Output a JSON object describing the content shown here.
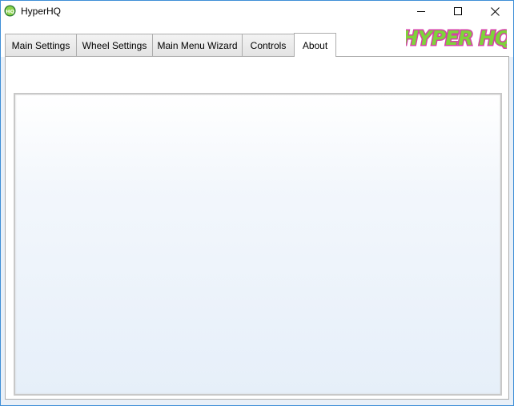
{
  "window": {
    "title": "HyperHQ",
    "app_icon": "hyperhq-app-icon"
  },
  "titlebar_buttons": {
    "minimize_icon": "minimize-icon",
    "maximize_icon": "maximize-icon",
    "close_icon": "close-icon"
  },
  "tabs": [
    {
      "label": "Main Settings",
      "active": false
    },
    {
      "label": "Wheel Settings",
      "active": false
    },
    {
      "label": "Main Menu Wizard",
      "active": false
    },
    {
      "label": "Controls",
      "active": false
    },
    {
      "label": "About",
      "active": true
    }
  ],
  "logo": {
    "text": "HYPER HQ",
    "colors": {
      "fill": "#7ed33a",
      "outline": "#d63fa8"
    }
  },
  "colors": {
    "window_border": "#3f8fd7",
    "panel_border": "#adadad",
    "content_gradient_bottom": "#e6eff9"
  }
}
